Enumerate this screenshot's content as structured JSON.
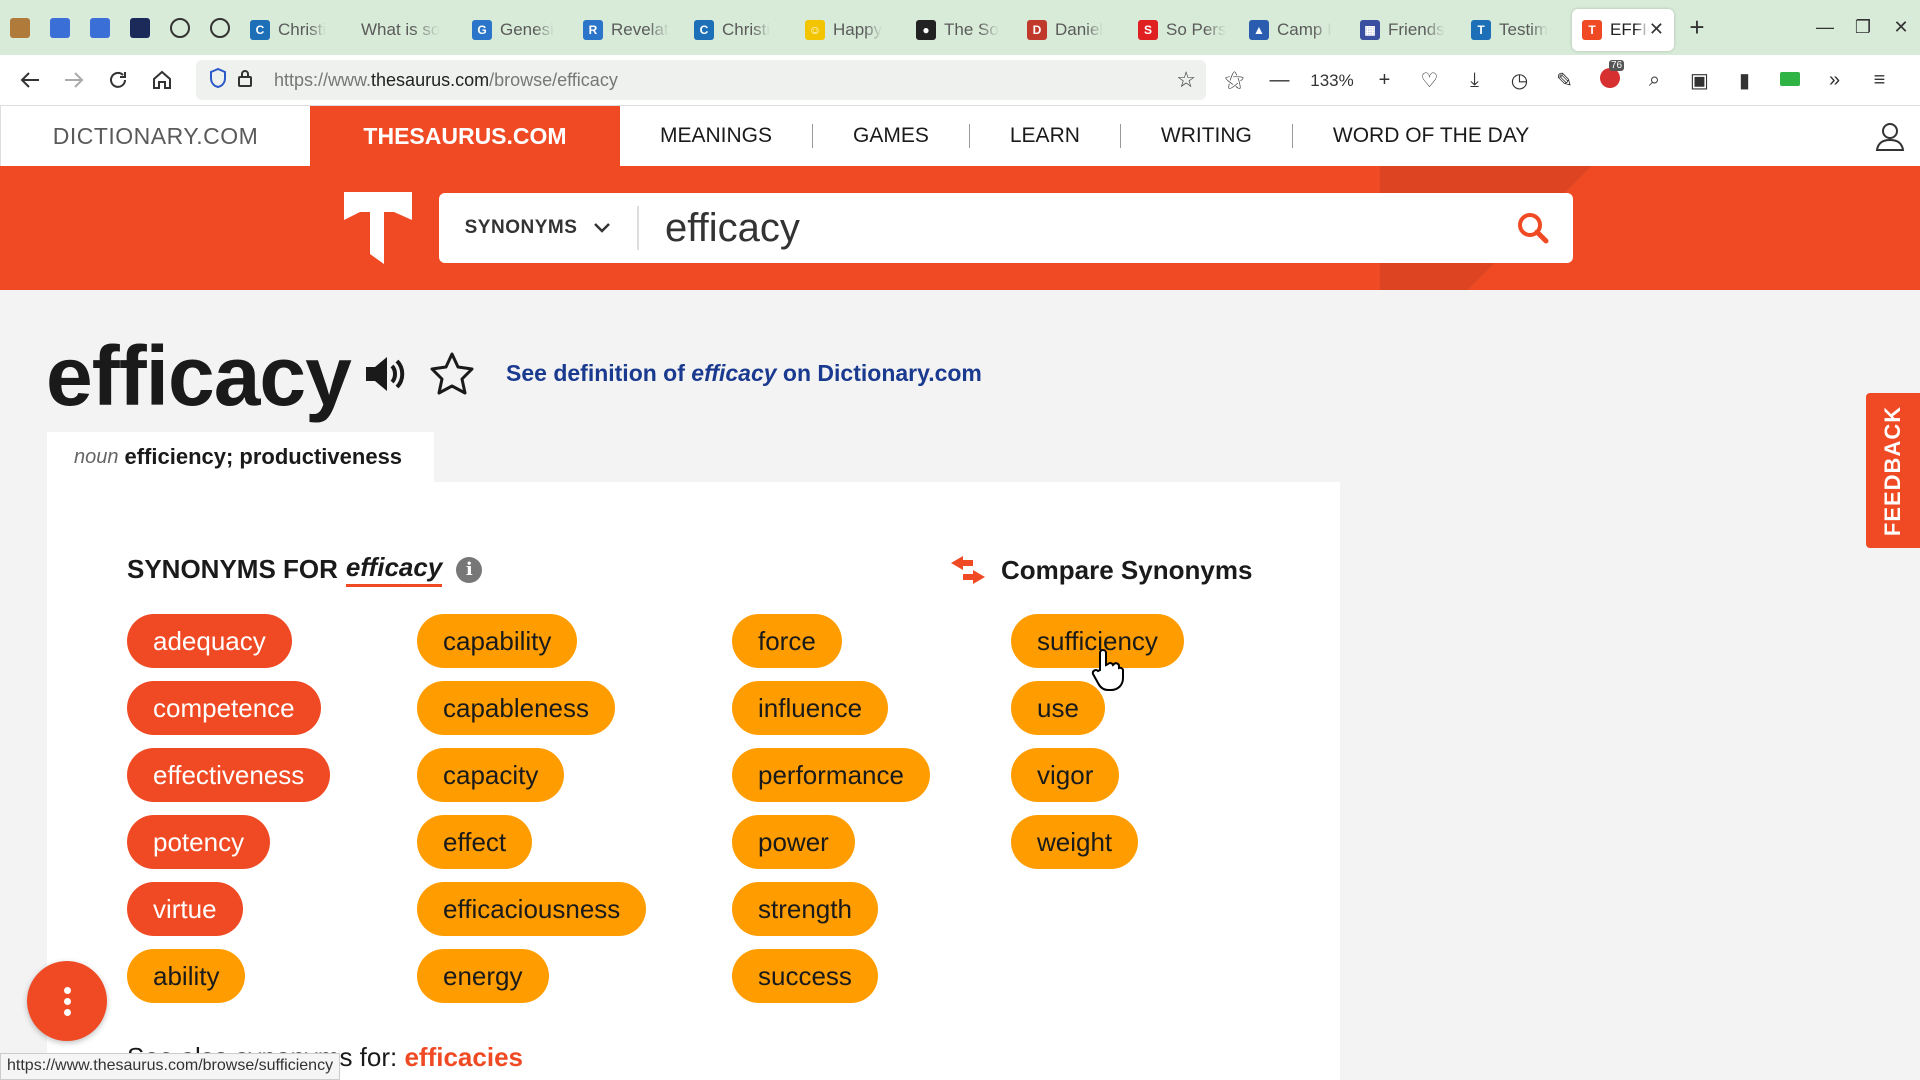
{
  "browser": {
    "pinned_tabs": [
      {
        "icon": "package-icon",
        "color": "#b07a3a"
      },
      {
        "icon": "docs-icon",
        "color": "#3b6fd8"
      },
      {
        "icon": "docs-icon",
        "color": "#3b6fd8"
      },
      {
        "icon": "ship-icon",
        "color": "#1c2a5a"
      },
      {
        "icon": "globe-icon",
        "color": "#333333"
      },
      {
        "icon": "globe-icon",
        "color": "#333333"
      }
    ],
    "tabs": [
      {
        "title": "Christi",
        "icon_color": "#1d6fb8",
        "glyph": "C"
      },
      {
        "title": "What is so",
        "icon_color": "",
        "glyph": ""
      },
      {
        "title": "Genesi",
        "icon_color": "#2a74c9",
        "glyph": "G"
      },
      {
        "title": "Revelat",
        "icon_color": "#2a74c9",
        "glyph": "R"
      },
      {
        "title": "Christi",
        "icon_color": "#1d6fb8",
        "glyph": "C"
      },
      {
        "title": "Happy",
        "icon_color": "#f3c400",
        "glyph": "☺"
      },
      {
        "title": "The So",
        "icon_color": "#222222",
        "glyph": "●"
      },
      {
        "title": "Daniel",
        "icon_color": "#c0392b",
        "glyph": "D"
      },
      {
        "title": "So Pers",
        "icon_color": "#e02020",
        "glyph": "S"
      },
      {
        "title": "Camp I",
        "icon_color": "#2a5db0",
        "glyph": "▲"
      },
      {
        "title": "Friends",
        "icon_color": "#3b4fa0",
        "glyph": "▦"
      },
      {
        "title": "Testim",
        "icon_color": "#1d6fb8",
        "glyph": "T"
      }
    ],
    "active_tab": {
      "title": "EFFIC",
      "icon_color": "#f04a24",
      "close": "✕"
    },
    "new_tab": "+",
    "url_prefix": "https://www.",
    "url_domain": "thesaurus.com",
    "url_path": "/browse/efficacy",
    "zoom": "133%",
    "abp_badge": "76",
    "status_url": "https://www.thesaurus.com/browse/sufficiency"
  },
  "site": {
    "dictionary_tab": "DICTIONARY.COM",
    "thesaurus_tab": "THESAURUS.COM",
    "menu": [
      "MEANINGS",
      "GAMES",
      "LEARN",
      "WRITING",
      "WORD OF THE DAY"
    ],
    "search_type": "SYNONYMS",
    "search_value": "efficacy",
    "accent": "#f04a24",
    "medium": "#ff9d00"
  },
  "entry": {
    "word": "efficacy",
    "def_link_prefix": "See definition of ",
    "def_link_word": "efficacy",
    "def_link_suffix": " on Dictionary.com",
    "pos": "noun",
    "sense": "efficiency; productiveness",
    "synonyms_for_label": "SYNONYMS FOR",
    "synonyms_for_word": "efficacy",
    "info_glyph": "i",
    "compare_label": "Compare Synonyms",
    "columns": [
      [
        {
          "word": "adequacy",
          "strength": "strong"
        },
        {
          "word": "competence",
          "strength": "strong"
        },
        {
          "word": "effectiveness",
          "strength": "strong"
        },
        {
          "word": "potency",
          "strength": "strong"
        },
        {
          "word": "virtue",
          "strength": "strong"
        },
        {
          "word": "ability",
          "strength": "medium"
        }
      ],
      [
        {
          "word": "capability",
          "strength": "medium"
        },
        {
          "word": "capableness",
          "strength": "medium"
        },
        {
          "word": "capacity",
          "strength": "medium"
        },
        {
          "word": "effect",
          "strength": "medium"
        },
        {
          "word": "efficaciousness",
          "strength": "medium"
        },
        {
          "word": "energy",
          "strength": "medium"
        }
      ],
      [
        {
          "word": "force",
          "strength": "medium"
        },
        {
          "word": "influence",
          "strength": "medium"
        },
        {
          "word": "performance",
          "strength": "medium"
        },
        {
          "word": "power",
          "strength": "medium"
        },
        {
          "word": "strength",
          "strength": "medium"
        },
        {
          "word": "success",
          "strength": "medium"
        }
      ],
      [
        {
          "word": "sufficiency",
          "strength": "medium"
        },
        {
          "word": "use",
          "strength": "medium"
        },
        {
          "word": "vigor",
          "strength": "medium"
        },
        {
          "word": "weight",
          "strength": "medium"
        }
      ]
    ],
    "more_prefix": "See also synonyms for: ",
    "more_word": "efficacies"
  },
  "feedback_label": "FEEDBACK"
}
